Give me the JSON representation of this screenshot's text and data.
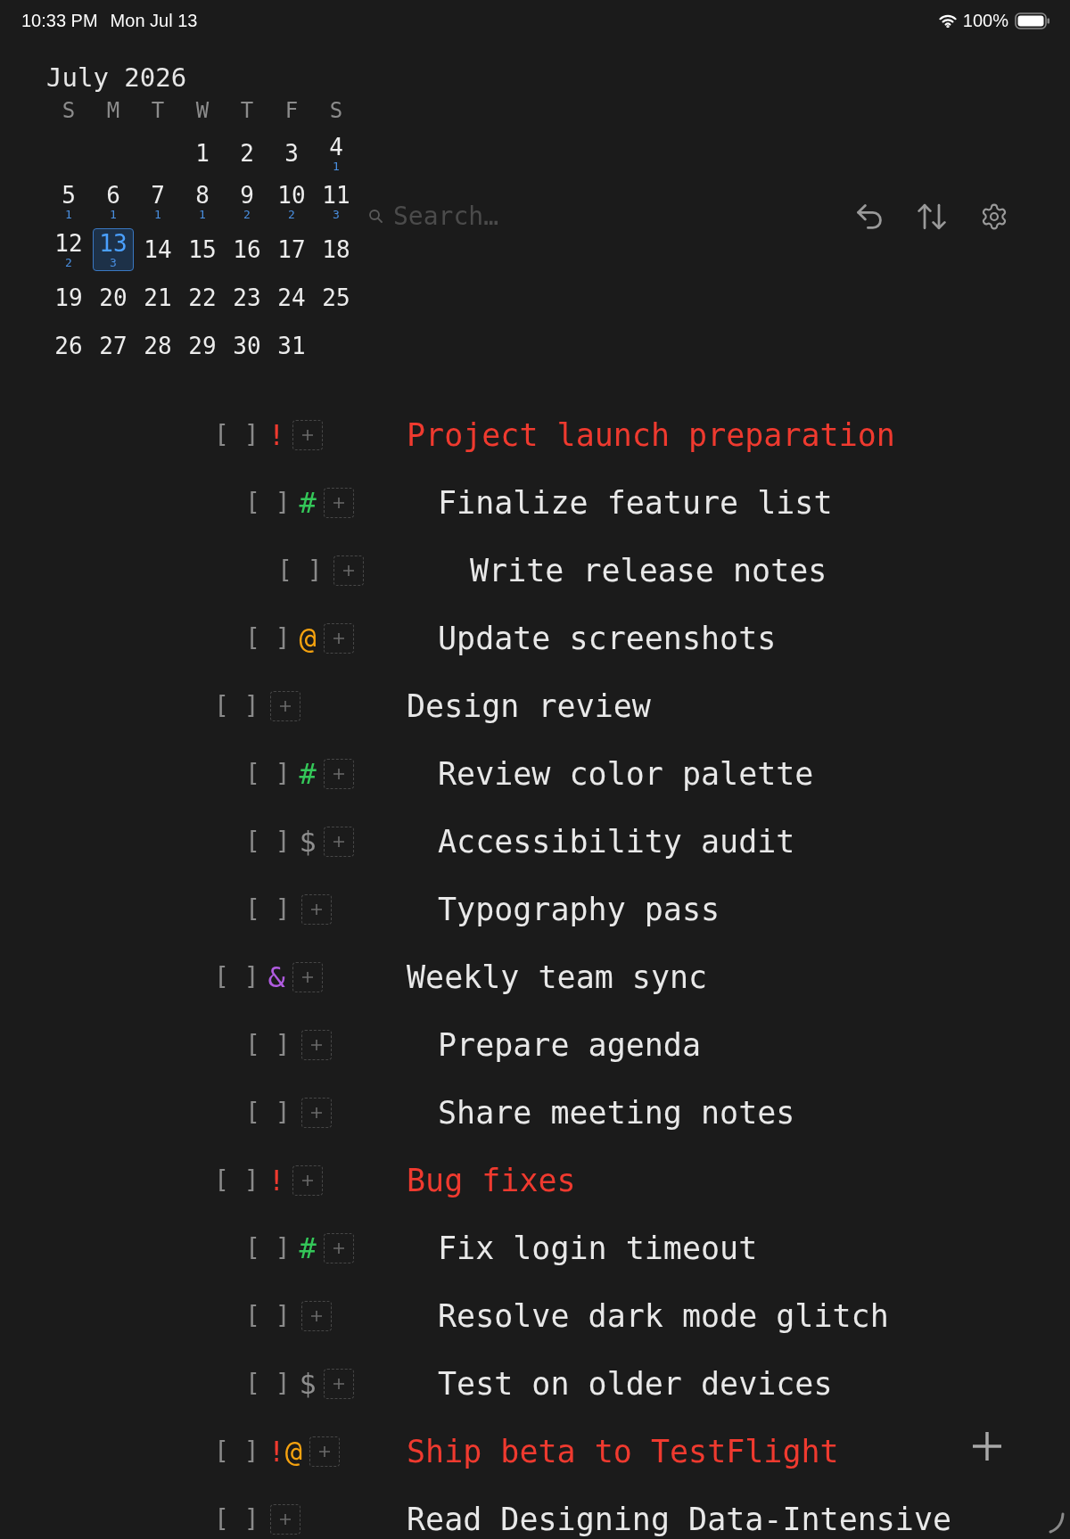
{
  "status_bar": {
    "time": "10:33 PM",
    "date": "Mon Jul 13",
    "battery": "100%"
  },
  "calendar": {
    "title": "July 2026",
    "weekdays": [
      "S",
      "M",
      "T",
      "W",
      "T",
      "F",
      "S"
    ],
    "weeks": [
      [
        {
          "day": "1",
          "selected": false
        },
        {
          "day": "2",
          "selected": false
        },
        {
          "day": "3",
          "selected": false
        },
        {
          "day": "4",
          "count": "1",
          "selected": false
        }
      ],
      [
        {
          "day": "5",
          "count": "1",
          "selected": false
        },
        {
          "day": "6",
          "count": "1",
          "selected": false
        },
        {
          "day": "7",
          "count": "1",
          "selected": false
        },
        {
          "day": "8",
          "count": "1",
          "selected": false
        },
        {
          "day": "9",
          "count": "2",
          "selected": false
        },
        {
          "day": "10",
          "count": "2",
          "selected": false
        },
        {
          "day": "11",
          "count": "3",
          "selected": false
        }
      ],
      [
        {
          "day": "12",
          "count": "2",
          "selected": false
        },
        {
          "day": "13",
          "count": "3",
          "selected": true
        },
        {
          "day": "14",
          "selected": false
        },
        {
          "day": "15",
          "selected": false
        },
        {
          "day": "16",
          "selected": false
        },
        {
          "day": "17",
          "selected": false
        },
        {
          "day": "18",
          "selected": false
        }
      ],
      [
        {
          "day": "19",
          "selected": false
        },
        {
          "day": "20",
          "selected": false
        },
        {
          "day": "21",
          "selected": false
        },
        {
          "day": "22",
          "selected": false
        },
        {
          "day": "23",
          "selected": false
        },
        {
          "day": "24",
          "selected": false
        },
        {
          "day": "25",
          "selected": false
        }
      ],
      [
        {
          "day": "26",
          "selected": false
        },
        {
          "day": "27",
          "selected": false
        },
        {
          "day": "28",
          "selected": false
        },
        {
          "day": "29",
          "selected": false
        },
        {
          "day": "30",
          "selected": false
        },
        {
          "day": "31",
          "selected": false
        }
      ]
    ]
  },
  "search": {
    "placeholder": "Search…"
  },
  "tasks": [
    {
      "checkbox": "[ ]",
      "checked": false,
      "tags": [
        {
          "symbol": "!",
          "color": "#ef3a2f"
        }
      ],
      "title": "Project launch preparation",
      "urgent": true,
      "children": [
        {
          "checkbox": "[ ]",
          "checked": false,
          "tags": [
            {
              "symbol": "#",
              "color": "#34c759"
            }
          ],
          "title": "Finalize feature list",
          "urgent": false,
          "children": [
            {
              "checkbox": "[ ]",
              "checked": false,
              "title": "Write release notes",
              "urgent": false
            }
          ]
        },
        {
          "checkbox": "[ ]",
          "checked": false,
          "tags": [
            {
              "symbol": "@",
              "color": "#f5a20f"
            }
          ],
          "title": "Update screenshots",
          "urgent": false
        }
      ]
    },
    {
      "checkbox": "[ ]",
      "checked": false,
      "title": "Design review",
      "urgent": false,
      "children": [
        {
          "checkbox": "[ ]",
          "checked": false,
          "tags": [
            {
              "symbol": "#",
              "color": "#34c759"
            }
          ],
          "title": "Review color palette",
          "urgent": false
        },
        {
          "checkbox": "[ ]",
          "checked": false,
          "tags": [
            {
              "symbol": "$",
              "color": "#8e8e8e"
            }
          ],
          "title": "Accessibility audit",
          "urgent": false
        },
        {
          "checkbox": "[ ]",
          "checked": false,
          "title": "Typography pass",
          "urgent": false
        }
      ]
    },
    {
      "checkbox": "[ ]",
      "checked": false,
      "tags": [
        {
          "symbol": "&",
          "color": "#b15ce0"
        }
      ],
      "title": "Weekly team sync",
      "urgent": false,
      "children": [
        {
          "checkbox": "[ ]",
          "checked": false,
          "title": "Prepare agenda",
          "urgent": false
        },
        {
          "checkbox": "[ ]",
          "checked": false,
          "title": "Share meeting notes",
          "urgent": false
        }
      ]
    },
    {
      "checkbox": "[ ]",
      "checked": false,
      "tags": [
        {
          "symbol": "!",
          "color": "#ef3a2f"
        }
      ],
      "title": "Bug fixes",
      "urgent": true,
      "children": [
        {
          "checkbox": "[ ]",
          "checked": false,
          "tags": [
            {
              "symbol": "#",
              "color": "#34c759"
            }
          ],
          "title": "Fix login timeout",
          "urgent": false
        },
        {
          "checkbox": "[ ]",
          "checked": false,
          "title": "Resolve dark mode glitch",
          "urgent": false
        },
        {
          "checkbox": "[ ]",
          "checked": false,
          "tags": [
            {
              "symbol": "$",
              "color": "#8e8e8e"
            }
          ],
          "title": "Test on older devices",
          "urgent": false
        }
      ]
    },
    {
      "checkbox": "[ ]",
      "checked": false,
      "tags": [
        {
          "symbol": "!",
          "color": "#ef3a2f"
        },
        {
          "symbol": "@",
          "color": "#f5a20f"
        }
      ],
      "title": "Ship beta to TestFlight",
      "urgent": true
    },
    {
      "checkbox": "[ ]",
      "checked": false,
      "title": "Read Designing Data-Intensive",
      "urgent": false
    }
  ]
}
